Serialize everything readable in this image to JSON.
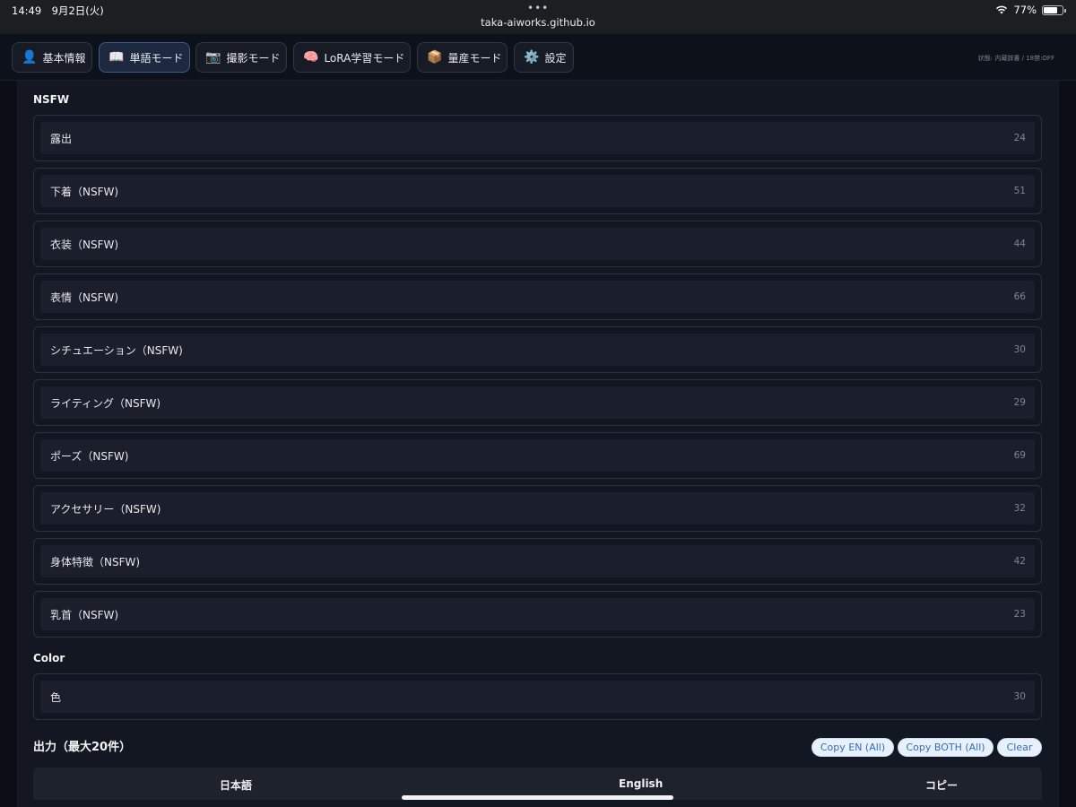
{
  "statusbar": {
    "time": "14:49　9月2日(火)",
    "dots": "•••",
    "url": "taka-aiworks.github.io",
    "battery": "77%",
    "battery_level": 0.77
  },
  "nav": {
    "tabs": [
      {
        "icon": "👤",
        "label": "基本情報"
      },
      {
        "icon": "📖",
        "label": "単語モード"
      },
      {
        "icon": "📷",
        "label": "撮影モード"
      },
      {
        "icon": "🧠",
        "label": "LoRA学習モード"
      },
      {
        "icon": "📦",
        "label": "量産モード"
      },
      {
        "icon": "⚙️",
        "label": "設定"
      }
    ],
    "status_note": "状態: 内蔵辞書 / 18禁:OFF"
  },
  "sections": {
    "nsfw": {
      "title": "NSFW",
      "items": [
        {
          "label": "露出",
          "count": "24"
        },
        {
          "label": "下着（NSFW)",
          "count": "51"
        },
        {
          "label": "衣装（NSFW)",
          "count": "44"
        },
        {
          "label": "表情（NSFW)",
          "count": "66"
        },
        {
          "label": "シチュエーション（NSFW)",
          "count": "30"
        },
        {
          "label": "ライティング（NSFW)",
          "count": "29"
        },
        {
          "label": "ポーズ（NSFW)",
          "count": "69"
        },
        {
          "label": "アクセサリー（NSFW)",
          "count": "32"
        },
        {
          "label": "身体特徴（NSFW)",
          "count": "42"
        },
        {
          "label": "乳首（NSFW)",
          "count": "23"
        }
      ]
    },
    "color": {
      "title": "Color",
      "items": [
        {
          "label": "色",
          "count": "30"
        }
      ]
    }
  },
  "output": {
    "title": "出力（最大20件）",
    "buttons": {
      "copy_en": "Copy EN (All)",
      "copy_both": "Copy BOTH (All)",
      "clear": "Clear"
    },
    "columns": [
      "日本語",
      "English",
      "コピー"
    ]
  }
}
